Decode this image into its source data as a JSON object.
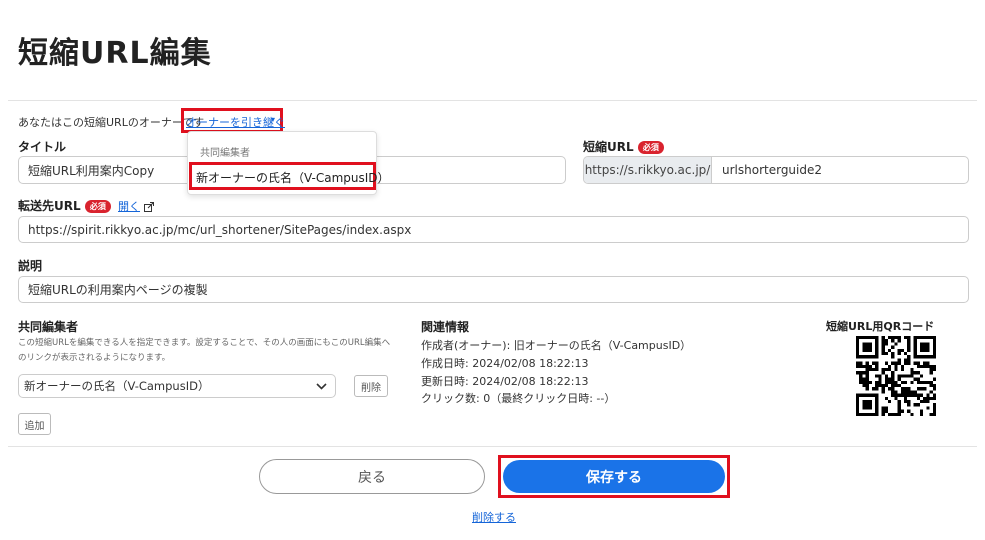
{
  "page": {
    "title": "短縮URL編集"
  },
  "owner": {
    "text": "あなたはこの短縮URLのオーナーです",
    "link": "オーナーを引き継ぐ",
    "caret": "▾"
  },
  "dropdown": {
    "header": "共同編集者",
    "option": "新オーナーの氏名（V-CampusID）"
  },
  "title_field": {
    "label": "タイトル",
    "value": "短縮URL利用案内Copy"
  },
  "short_url": {
    "label": "短縮URL",
    "required": "必須",
    "prefix": "https://s.rikkyo.ac.jp/",
    "value": "urlshorterguide2"
  },
  "forward_url": {
    "label": "転送先URL",
    "required": "必須",
    "open_link": "開く",
    "value": "https://spirit.rikkyo.ac.jp/mc/url_shortener/SitePages/index.aspx"
  },
  "description": {
    "label": "説明",
    "value": "短縮URLの利用案内ページの複製"
  },
  "co_editors": {
    "label": "共同編集者",
    "help_line1": "この短縮URLを編集できる人を指定できます。設定することで、その人の画面にもこのURL編集へ",
    "help_line2": "のリンクが表示されるようになります。",
    "selected": "新オーナーの氏名（V-CampusID）",
    "remove_label": "削除",
    "add_label": "追加"
  },
  "related": {
    "label": "関連情報",
    "creator": "作成者(オーナー): 旧オーナーの氏名（V-CampusID）",
    "created": "作成日時: 2024/02/08 18:22:13",
    "updated": "更新日時: 2024/02/08 18:22:13",
    "clicks": "クリック数: 0（最終クリック日時: --）"
  },
  "qr": {
    "label": "短縮URL用QRコード"
  },
  "actions": {
    "back": "戻る",
    "save": "保存する",
    "delete": "削除する"
  },
  "colors": {
    "accent": "#1a73e8",
    "highlight": "#e0101e",
    "required": "#d9232e"
  }
}
